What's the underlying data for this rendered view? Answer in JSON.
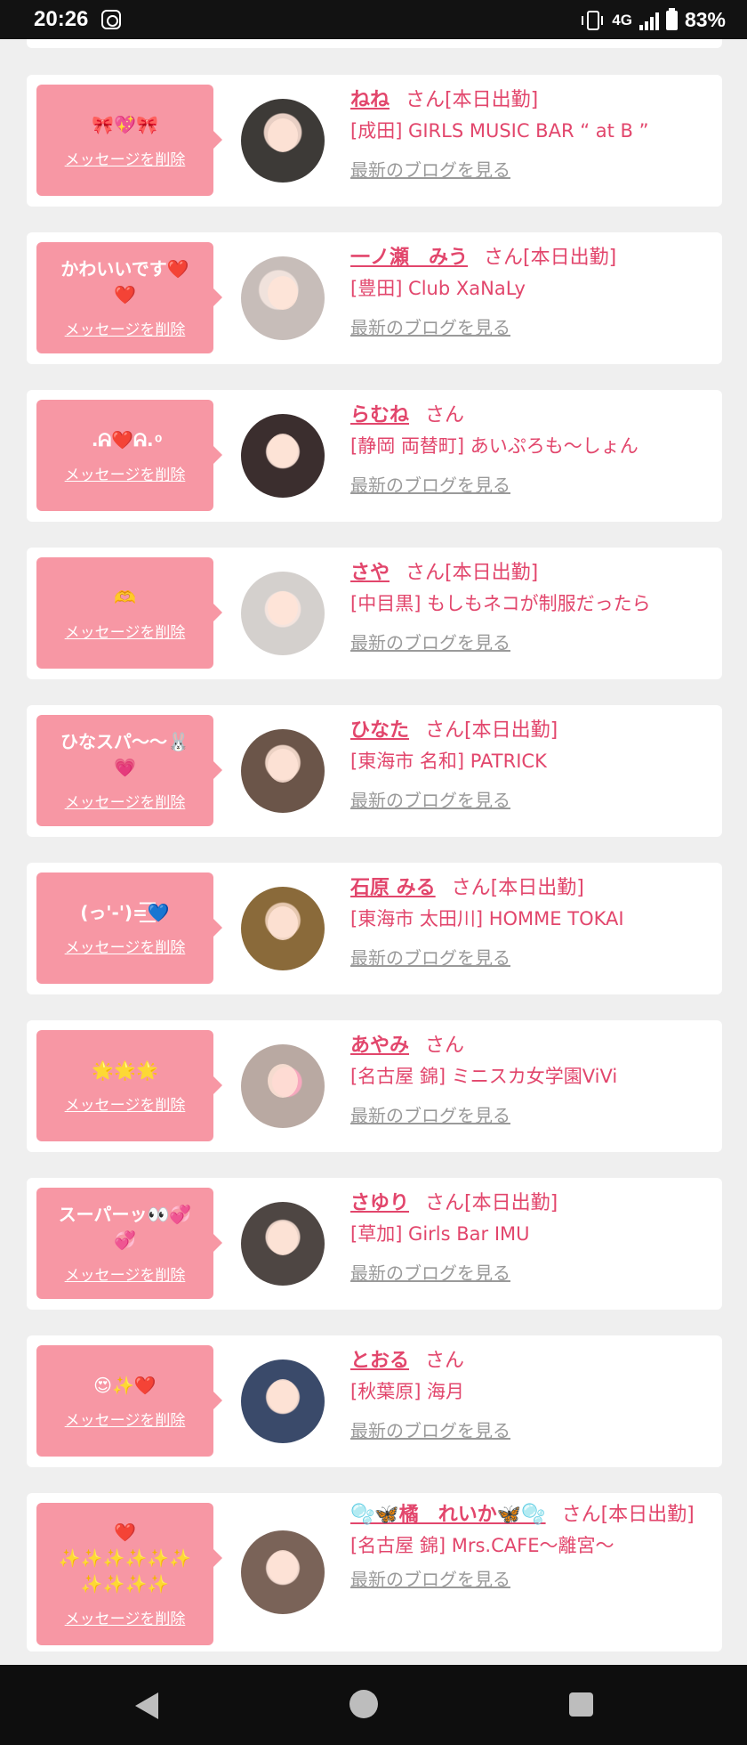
{
  "status_bar": {
    "time": "20:26",
    "network": "4G",
    "battery": "83%"
  },
  "list": {
    "delete_label": "メッセージを削除",
    "blog_label": "最新のブログを見る",
    "items": [
      {
        "message": "🎀💖🎀",
        "name": "ねね",
        "suffix": "さん[本日出勤]",
        "shop": "[成田] GIRLS MUSIC BAR “ at B ”",
        "avatar_color": "#3d3a37"
      },
      {
        "message": "かわいいです❤️\n❤️",
        "name": "一ノ瀬　みう",
        "suffix": "さん[本日出勤]",
        "shop": "[豊田] Club XaNaLy",
        "avatar_color": "#c7bdb9"
      },
      {
        "message": ".ᕱ❤️ᕱ. ͦ",
        "name": "らむね",
        "suffix": "さん",
        "shop": "[静岡 両替町] あいぷろも〜しょん",
        "avatar_color": "#3b2e2e"
      },
      {
        "message": "🫶",
        "name": "さや",
        "suffix": "さん[本日出勤]",
        "shop": "[中目黒] もしもネコが制服だったら",
        "avatar_color": "#d4d0cd"
      },
      {
        "message": "ひなスパ〜〜🐰\n💗",
        "name": "ひなた",
        "suffix": "さん[本日出勤]",
        "shop": "[東海市 名和] PATRICK",
        "avatar_color": "#6b5549"
      },
      {
        "message": "(っ'-')=͟͟͞͞💙",
        "name": "石原 みる",
        "suffix": "さん[本日出勤]",
        "shop": "[東海市 太田川] HOMME TOKAI",
        "avatar_color": "#8a6a3a"
      },
      {
        "message": "🌟🌟🌟",
        "name": "あやみ",
        "suffix": "さん",
        "shop": "[名古屋 錦] ミニスカ女学園ViVi",
        "avatar_color": "#b9a9a2"
      },
      {
        "message": "スーパーッ👀💞\n💞",
        "name": "さゆり",
        "suffix": "さん[本日出勤]",
        "shop": "[草加] Girls Bar IMU",
        "avatar_color": "#4e4643"
      },
      {
        "message": "😍✨❤️",
        "name": "とおる",
        "suffix": "さん",
        "shop": "[秋葉原] 海月",
        "avatar_color": "#3a4a6a"
      },
      {
        "message": "❤️\n✨✨✨✨✨✨\n✨✨✨✨",
        "name": "🫧🦋橘　れいか🦋🫧",
        "suffix": "さん[本日出勤]",
        "shop": "[名古屋 錦] Mrs.CAFE〜離宮〜",
        "avatar_color": "#7a6358"
      }
    ]
  }
}
